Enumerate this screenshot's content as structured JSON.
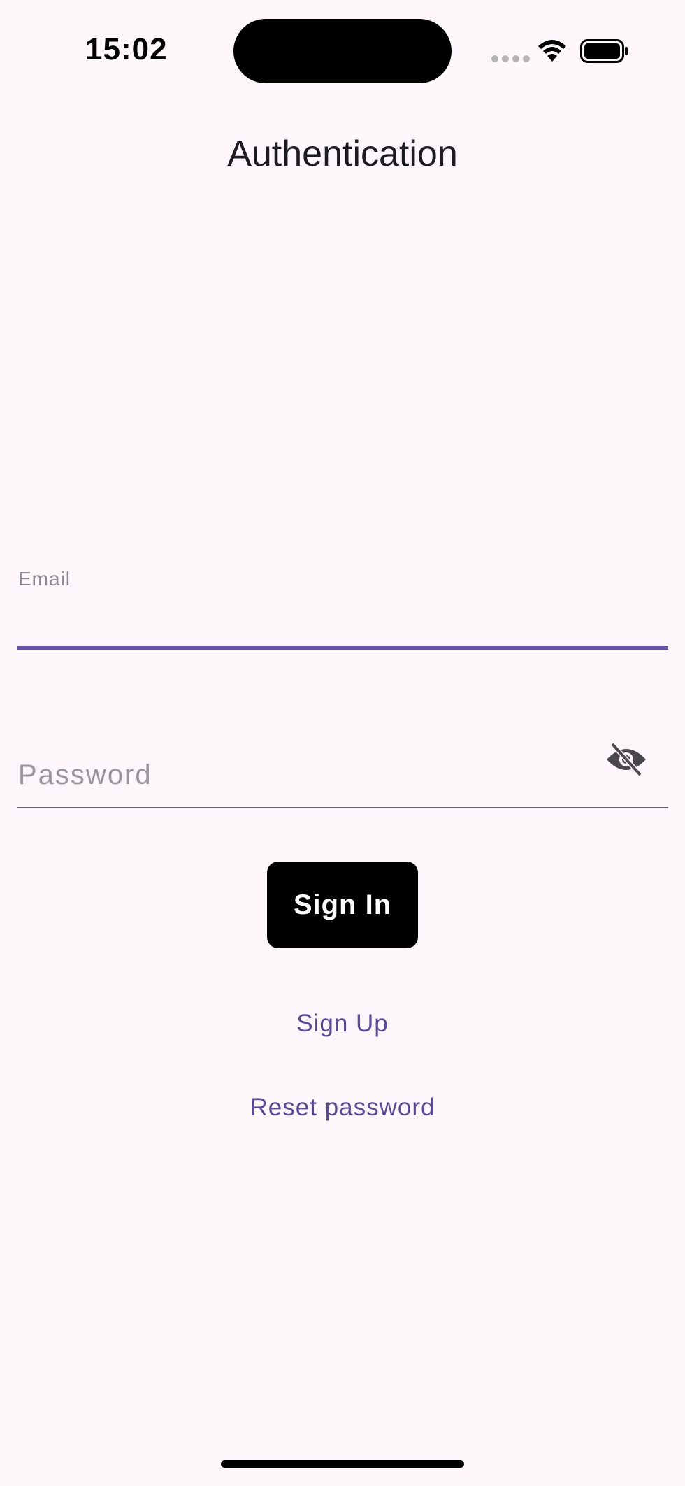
{
  "status_bar": {
    "time": "15:02",
    "icons": [
      "cellular-signal-icon",
      "wifi-icon",
      "battery-icon"
    ]
  },
  "header": {
    "title": "Authentication"
  },
  "form": {
    "email_label": "Email",
    "email_value": "",
    "password_placeholder": "Password",
    "password_value": "",
    "visibility_icon": "eye-off-icon",
    "sign_in_label": "Sign In",
    "sign_up_label": "Sign Up",
    "reset_password_label": "Reset password"
  },
  "colors": {
    "background": "#FDF7FC",
    "accent": "#6352A5",
    "link": "#5A4A94",
    "primary_button": "#000000"
  }
}
